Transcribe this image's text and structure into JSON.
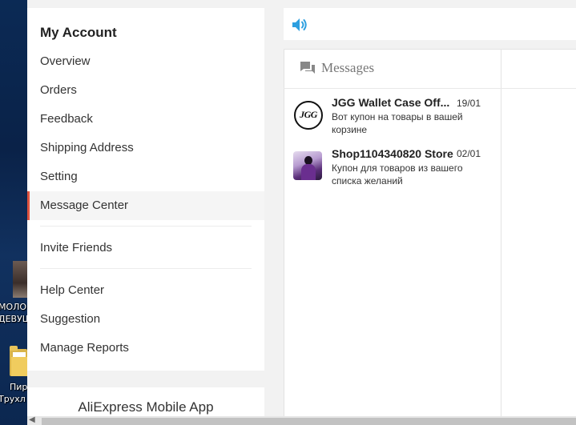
{
  "desktop": {
    "icon1_label_line1": "МОЛО",
    "icon1_label_line2": "ДЕВУЩ",
    "icon2_label_line1": "Пир",
    "icon2_label_line2": "Трухл"
  },
  "sidebar": {
    "title": "My Account",
    "items": [
      {
        "label": "Overview"
      },
      {
        "label": "Orders"
      },
      {
        "label": "Feedback"
      },
      {
        "label": "Shipping Address"
      },
      {
        "label": "Setting"
      },
      {
        "label": "Message Center",
        "active": true
      },
      {
        "label": "Invite Friends"
      },
      {
        "label": "Help Center"
      },
      {
        "label": "Suggestion"
      },
      {
        "label": "Manage Reports"
      }
    ],
    "app_title": "AliExpress Mobile App"
  },
  "topbar": {
    "icon": "speaker-icon"
  },
  "messages": {
    "heading": "Messages",
    "heading_icon": "chat-bubbles-icon",
    "conversations": [
      {
        "name": "JGG Wallet Case Off...",
        "date": "19/01",
        "preview": "Вот купон на товары в вашей корзине",
        "avatar_text": "JGG"
      },
      {
        "name": "Shop1104340820 Store",
        "date": "02/01",
        "preview": "Купон для товаров из вашего списка желаний"
      }
    ]
  },
  "colors": {
    "accent": "#e0533f",
    "speaker": "#2d9fe0"
  }
}
